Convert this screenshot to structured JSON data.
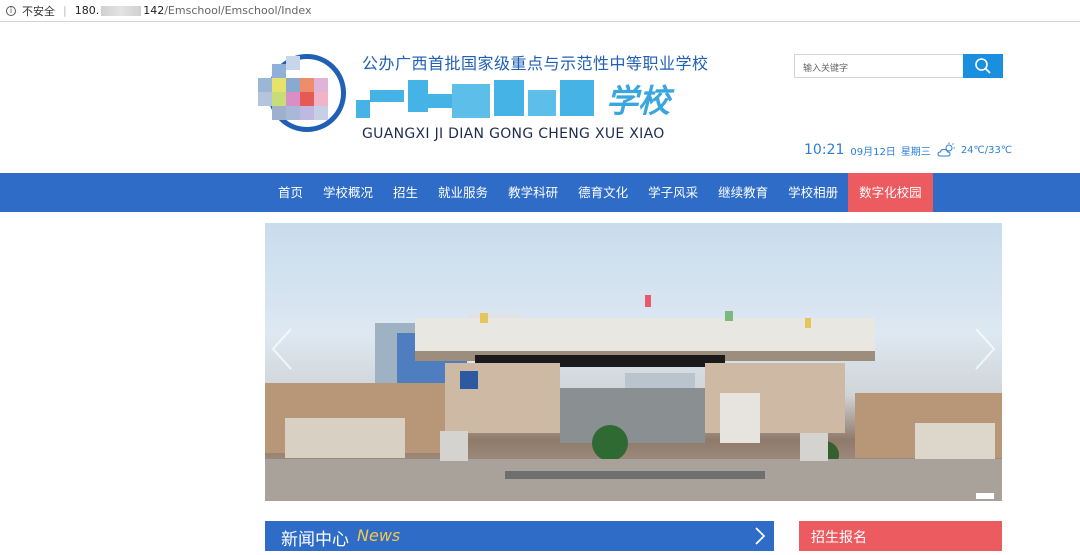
{
  "address_bar": {
    "security_text": "不安全",
    "host_prefix": "180.",
    "host_suffix": "142",
    "path": "/Emschool/Emschool/Index"
  },
  "header": {
    "school_name_cn": "公办广西首批国家级重点与示范性中等职业学校",
    "school_name_tail": "学校",
    "school_name_en": "GUANGXI JI DIAN GONG CHENG XUE XIAO",
    "search_placeholder": "输入关键字",
    "time": "10:21",
    "date": "09月12日",
    "weekday": "星期三",
    "weather_icon": "cloud-sun-icon",
    "temperature": "24℃/33℃"
  },
  "nav": {
    "items": [
      "首页",
      "学校概况",
      "招生",
      "就业服务",
      "教学科研",
      "德育文化",
      "学子风采",
      "继续教育",
      "学校相册",
      "数字化校园"
    ],
    "active_index": 9
  },
  "sections": {
    "news_title_cn": "新闻中心",
    "news_title_en": "News",
    "enroll_title": "招生报名"
  },
  "colors": {
    "nav_blue": "#2e6cc7",
    "active_red": "#ec5b60",
    "search_blue": "#1a8fe0",
    "text_blue": "#1f5fb5",
    "news_en_yellow": "#f2c94c"
  }
}
